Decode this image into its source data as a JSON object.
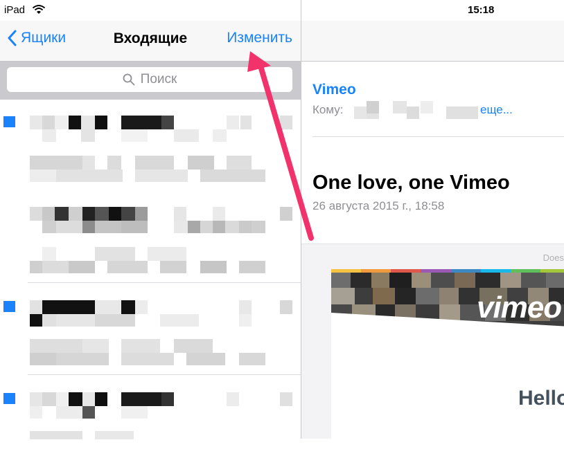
{
  "status": {
    "carrier": "iPad",
    "time": "15:18"
  },
  "nav": {
    "back_label": "Ящики",
    "title": "Входящие",
    "edit_label": "Изменить"
  },
  "search": {
    "placeholder": "Поиск"
  },
  "message": {
    "from": "Vimeo",
    "to_label": "Кому:",
    "more_label": "еще...",
    "subject": "One love, one Vimeo",
    "date": "26 августа 2015 г., 18:58",
    "body_hint": "Does",
    "logo_text": "vimeo",
    "hello_text": "Hello"
  },
  "colors": {
    "accent": "#1a82fb",
    "arrow": "#f2336b"
  }
}
